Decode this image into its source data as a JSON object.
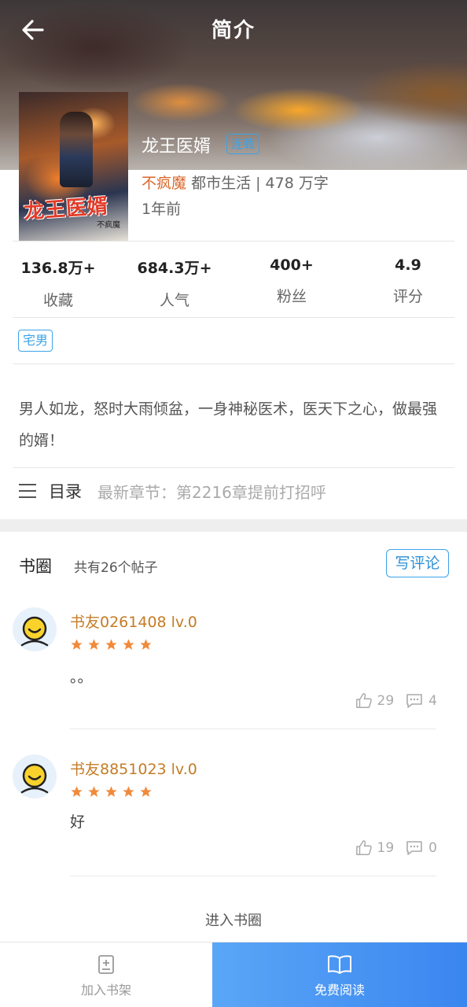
{
  "header": {
    "title": "简介"
  },
  "book": {
    "title": "龙王医婿",
    "status": "连载",
    "author": "不疯魔",
    "genre_words": "都市生活 | 478 万字",
    "updated": "1年前",
    "cover_title": "龙王医婿",
    "cover_author": "不疯魔"
  },
  "stats": [
    {
      "value": "136.8万+",
      "label": "收藏"
    },
    {
      "value": "684.3万+",
      "label": "人气"
    },
    {
      "value": "400+",
      "label": "粉丝"
    },
    {
      "value": "4.9",
      "label": "评分"
    }
  ],
  "tags": [
    "宅男"
  ],
  "description": "男人如龙，怒时大雨倾盆，一身神秘医术，医天下之心，做最强的婿！",
  "toc": {
    "label": "目录",
    "latest": "最新章节：第2216章提前打招呼"
  },
  "circle": {
    "title": "书圈",
    "count": "共有26个帖子",
    "write_button": "写评论",
    "enter": "进入书圈"
  },
  "comments": [
    {
      "user": "书友0261408 lv.0",
      "stars": 5,
      "text": "。。",
      "likes": "29",
      "replies": "4"
    },
    {
      "user": "书友8851023 lv.0",
      "stars": 5,
      "text": "好",
      "likes": "19",
      "replies": "0"
    }
  ],
  "bottom": {
    "add_shelf": "加入书架",
    "read": "免费阅读"
  },
  "colors": {
    "accent": "#3ba3e8",
    "author": "#d9672a",
    "username": "#c47c26",
    "star": "#f08a3c",
    "read_button": "#3a86f0"
  }
}
